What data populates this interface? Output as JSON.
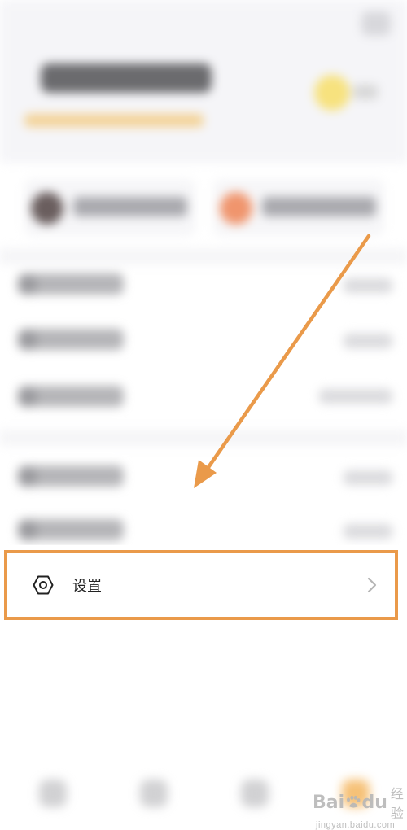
{
  "settings": {
    "label": "设置",
    "icon": "settings-gear-icon",
    "chevron_icon": "chevron-right-icon"
  },
  "annotation": {
    "arrow_color": "#ea9a4a",
    "highlight_color": "#ea9a4a"
  },
  "watermark": {
    "brand_left": "Bai",
    "brand_right": "du",
    "brand_suffix": "经验",
    "url": "jingyan.baidu.com"
  }
}
